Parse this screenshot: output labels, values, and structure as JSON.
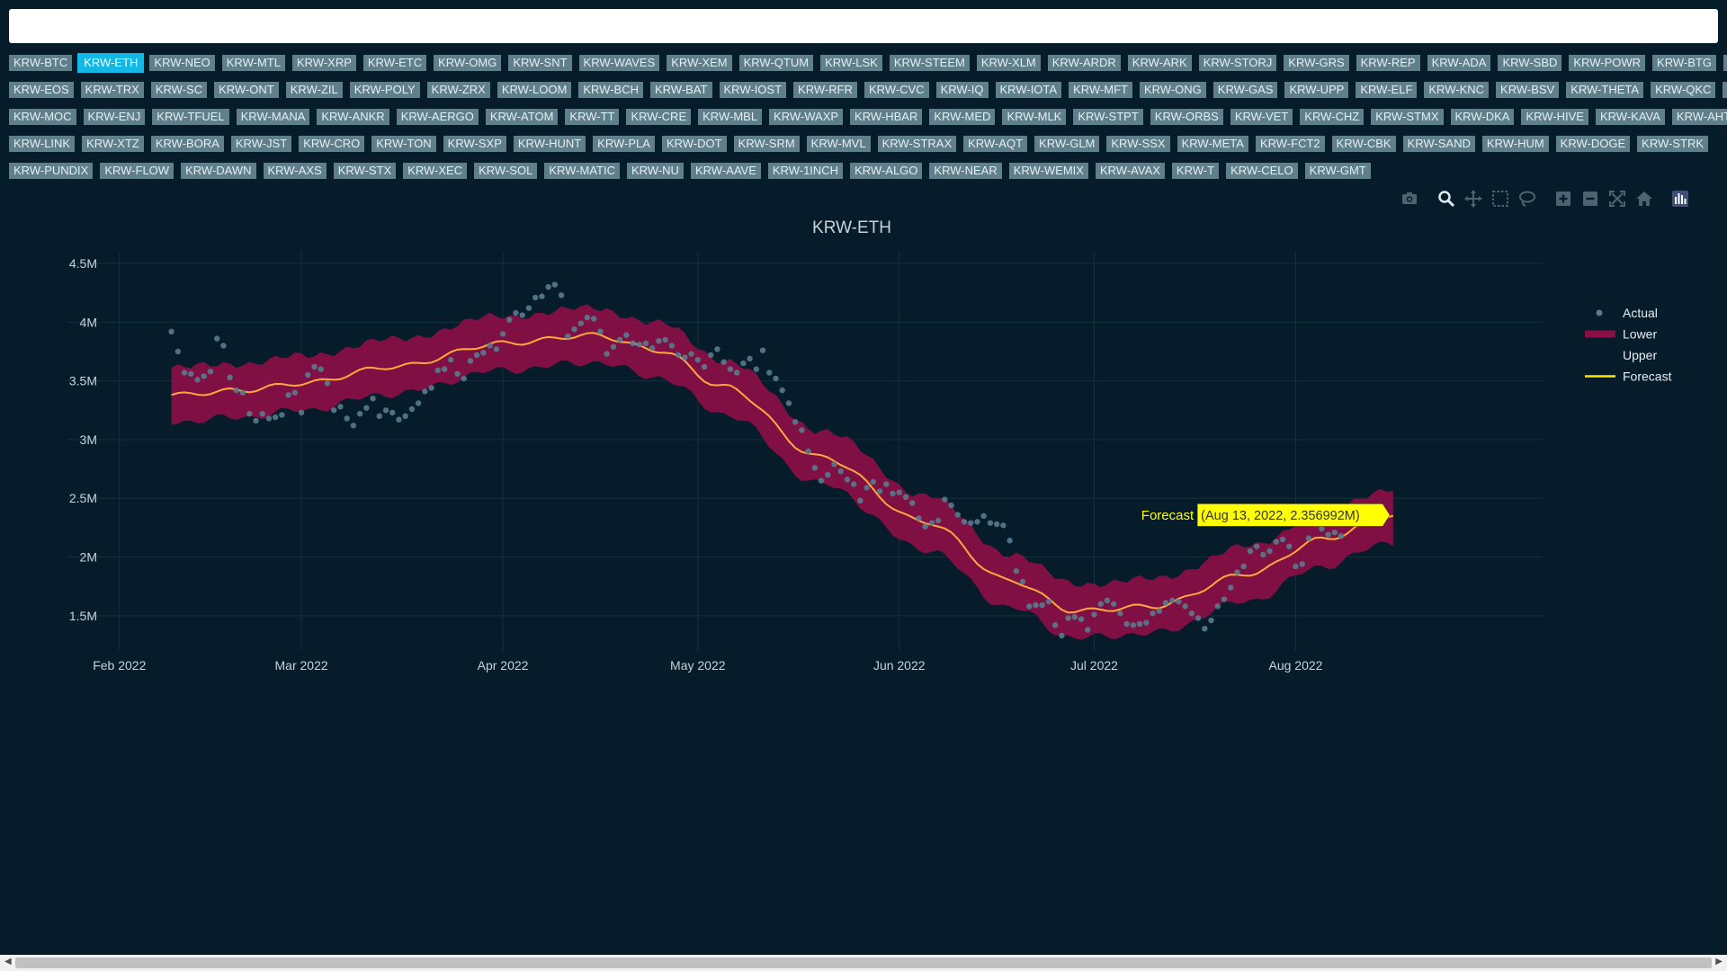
{
  "search": {
    "value": "",
    "placeholder": ""
  },
  "tickers": [
    [
      "KRW-BTC",
      "KRW-ETH",
      "KRW-NEO",
      "KRW-MTL",
      "KRW-XRP",
      "KRW-ETC",
      "KRW-OMG",
      "KRW-SNT",
      "KRW-WAVES",
      "KRW-XEM",
      "KRW-QTUM",
      "KRW-LSK",
      "KRW-STEEM",
      "KRW-XLM",
      "KRW-ARDR",
      "KRW-ARK",
      "KRW-STORJ",
      "KRW-GRS",
      "KRW-REP",
      "KRW-ADA",
      "KRW-SBD",
      "KRW-POWR",
      "KRW-BTG",
      "KRW-ICX"
    ],
    [
      "KRW-EOS",
      "KRW-TRX",
      "KRW-SC",
      "KRW-ONT",
      "KRW-ZIL",
      "KRW-POLY",
      "KRW-ZRX",
      "KRW-LOOM",
      "KRW-BCH",
      "KRW-BAT",
      "KRW-IOST",
      "KRW-RFR",
      "KRW-CVC",
      "KRW-IQ",
      "KRW-IOTA",
      "KRW-MFT",
      "KRW-ONG",
      "KRW-GAS",
      "KRW-UPP",
      "KRW-ELF",
      "KRW-KNC",
      "KRW-BSV",
      "KRW-THETA",
      "KRW-QKC",
      "KRW-BTT"
    ],
    [
      "KRW-MOC",
      "KRW-ENJ",
      "KRW-TFUEL",
      "KRW-MANA",
      "KRW-ANKR",
      "KRW-AERGO",
      "KRW-ATOM",
      "KRW-TT",
      "KRW-CRE",
      "KRW-MBL",
      "KRW-WAXP",
      "KRW-HBAR",
      "KRW-MED",
      "KRW-MLK",
      "KRW-STPT",
      "KRW-ORBS",
      "KRW-VET",
      "KRW-CHZ",
      "KRW-STMX",
      "KRW-DKA",
      "KRW-HIVE",
      "KRW-KAVA",
      "KRW-AHT"
    ],
    [
      "KRW-LINK",
      "KRW-XTZ",
      "KRW-BORA",
      "KRW-JST",
      "KRW-CRO",
      "KRW-TON",
      "KRW-SXP",
      "KRW-HUNT",
      "KRW-PLA",
      "KRW-DOT",
      "KRW-SRM",
      "KRW-MVL",
      "KRW-STRAX",
      "KRW-AQT",
      "KRW-GLM",
      "KRW-SSX",
      "KRW-META",
      "KRW-FCT2",
      "KRW-CBK",
      "KRW-SAND",
      "KRW-HUM",
      "KRW-DOGE",
      "KRW-STRK"
    ],
    [
      "KRW-PUNDIX",
      "KRW-FLOW",
      "KRW-DAWN",
      "KRW-AXS",
      "KRW-STX",
      "KRW-XEC",
      "KRW-SOL",
      "KRW-MATIC",
      "KRW-NU",
      "KRW-AAVE",
      "KRW-1INCH",
      "KRW-ALGO",
      "KRW-NEAR",
      "KRW-WEMIX",
      "KRW-AVAX",
      "KRW-T",
      "KRW-CELO",
      "KRW-GMT"
    ]
  ],
  "selected_ticker": "KRW-ETH",
  "modebar": [
    "camera-icon",
    "zoom-icon",
    "pan-icon",
    "box-select-icon",
    "lasso-icon",
    "zoom-in-icon",
    "zoom-out-icon",
    "autoscale-icon",
    "reset-axes-icon",
    "plotly-logo-icon"
  ],
  "colors": {
    "background": "#061c2b",
    "band": "#8b0f47",
    "forecast": "#ffa83c",
    "forecast_legend": "#ffe600",
    "actual": "#587b8e",
    "tooltip_bg": "#ffff00",
    "active_ticker": "#12b8e6"
  },
  "chart_data": {
    "type": "line",
    "title": "KRW-ETH",
    "x_start": "2022-02-09",
    "x_end": "2022-08-16",
    "xlim": [
      "2022-01-24",
      "2022-09-08"
    ],
    "ylim": [
      1200000,
      4600000
    ],
    "x_ticks": [
      "Feb 2022",
      "Mar 2022",
      "Apr 2022",
      "May 2022",
      "Jun 2022",
      "Jul 2022",
      "Aug 2022"
    ],
    "y_ticks": [
      "1.5M",
      "2M",
      "2.5M",
      "3M",
      "3.5M",
      "4M",
      "4.5M"
    ],
    "legend": {
      "placement": "top-right",
      "entries": [
        "Actual",
        "Lower",
        "Upper",
        "Forecast"
      ]
    },
    "forecast_knots": [
      [
        "2022-02-09",
        3380000
      ],
      [
        "2022-02-20",
        3420000
      ],
      [
        "2022-03-01",
        3480000
      ],
      [
        "2022-03-15",
        3620000
      ],
      [
        "2022-04-01",
        3820000
      ],
      [
        "2022-04-15",
        3890000
      ],
      [
        "2022-04-25",
        3760000
      ],
      [
        "2022-05-05",
        3450000
      ],
      [
        "2022-05-20",
        2850000
      ],
      [
        "2022-06-05",
        2300000
      ],
      [
        "2022-06-18",
        1800000
      ],
      [
        "2022-06-28",
        1540000
      ],
      [
        "2022-07-10",
        1580000
      ],
      [
        "2022-07-25",
        1860000
      ],
      [
        "2022-08-05",
        2150000
      ],
      [
        "2022-08-16",
        2360000
      ]
    ],
    "band_halfwidth": 230000,
    "actual_points": [
      [
        "2022-02-09",
        3920000
      ],
      [
        "2022-02-10",
        3750000
      ],
      [
        "2022-02-11",
        3570000
      ],
      [
        "2022-02-12",
        3560000
      ],
      [
        "2022-02-13",
        3510000
      ],
      [
        "2022-02-14",
        3540000
      ],
      [
        "2022-02-15",
        3580000
      ],
      [
        "2022-02-16",
        3860000
      ],
      [
        "2022-02-17",
        3800000
      ],
      [
        "2022-02-18",
        3530000
      ],
      [
        "2022-02-19",
        3420000
      ],
      [
        "2022-02-20",
        3400000
      ],
      [
        "2022-02-21",
        3220000
      ],
      [
        "2022-02-22",
        3160000
      ],
      [
        "2022-02-23",
        3220000
      ],
      [
        "2022-02-24",
        3180000
      ],
      [
        "2022-02-25",
        3190000
      ],
      [
        "2022-02-26",
        3210000
      ],
      [
        "2022-02-27",
        3380000
      ],
      [
        "2022-02-28",
        3400000
      ],
      [
        "2022-03-01",
        3230000
      ],
      [
        "2022-03-02",
        3550000
      ],
      [
        "2022-03-03",
        3620000
      ],
      [
        "2022-03-04",
        3600000
      ],
      [
        "2022-03-05",
        3480000
      ],
      [
        "2022-03-06",
        3250000
      ],
      [
        "2022-03-07",
        3280000
      ],
      [
        "2022-03-08",
        3180000
      ],
      [
        "2022-03-09",
        3120000
      ],
      [
        "2022-03-10",
        3220000
      ],
      [
        "2022-03-11",
        3270000
      ],
      [
        "2022-03-12",
        3350000
      ],
      [
        "2022-03-13",
        3200000
      ],
      [
        "2022-03-14",
        3250000
      ],
      [
        "2022-03-15",
        3230000
      ],
      [
        "2022-03-16",
        3170000
      ],
      [
        "2022-03-17",
        3200000
      ],
      [
        "2022-03-18",
        3260000
      ],
      [
        "2022-03-19",
        3310000
      ],
      [
        "2022-03-20",
        3410000
      ],
      [
        "2022-03-21",
        3440000
      ],
      [
        "2022-03-22",
        3590000
      ],
      [
        "2022-03-23",
        3600000
      ],
      [
        "2022-03-24",
        3680000
      ],
      [
        "2022-03-25",
        3560000
      ],
      [
        "2022-03-26",
        3520000
      ],
      [
        "2022-03-27",
        3670000
      ],
      [
        "2022-03-28",
        3720000
      ],
      [
        "2022-03-29",
        3740000
      ],
      [
        "2022-03-30",
        3800000
      ],
      [
        "2022-03-31",
        3770000
      ],
      [
        "2022-04-01",
        3900000
      ],
      [
        "2022-04-02",
        4020000
      ],
      [
        "2022-04-03",
        4080000
      ],
      [
        "2022-04-04",
        4060000
      ],
      [
        "2022-04-05",
        4120000
      ],
      [
        "2022-04-06",
        4210000
      ],
      [
        "2022-04-07",
        4220000
      ],
      [
        "2022-04-08",
        4300000
      ],
      [
        "2022-04-09",
        4320000
      ],
      [
        "2022-04-10",
        4230000
      ],
      [
        "2022-04-11",
        3880000
      ],
      [
        "2022-04-12",
        3940000
      ],
      [
        "2022-04-13",
        3990000
      ],
      [
        "2022-04-14",
        4040000
      ],
      [
        "2022-04-15",
        4030000
      ],
      [
        "2022-04-16",
        3920000
      ],
      [
        "2022-04-17",
        3730000
      ],
      [
        "2022-04-18",
        3790000
      ],
      [
        "2022-04-19",
        3850000
      ],
      [
        "2022-04-20",
        3890000
      ],
      [
        "2022-04-21",
        3820000
      ],
      [
        "2022-04-22",
        3810000
      ],
      [
        "2022-04-23",
        3820000
      ],
      [
        "2022-04-24",
        3780000
      ],
      [
        "2022-04-25",
        3840000
      ],
      [
        "2022-04-26",
        3850000
      ],
      [
        "2022-04-27",
        3800000
      ],
      [
        "2022-04-28",
        3720000
      ],
      [
        "2022-04-29",
        3700000
      ],
      [
        "2022-04-30",
        3730000
      ],
      [
        "2022-05-01",
        3680000
      ],
      [
        "2022-05-02",
        3620000
      ],
      [
        "2022-05-03",
        3720000
      ],
      [
        "2022-05-04",
        3770000
      ],
      [
        "2022-05-05",
        3660000
      ],
      [
        "2022-05-06",
        3600000
      ],
      [
        "2022-05-07",
        3570000
      ],
      [
        "2022-05-08",
        3650000
      ],
      [
        "2022-05-09",
        3690000
      ],
      [
        "2022-05-10",
        3600000
      ],
      [
        "2022-05-11",
        3760000
      ],
      [
        "2022-05-12",
        3570000
      ],
      [
        "2022-05-13",
        3520000
      ],
      [
        "2022-05-14",
        3420000
      ],
      [
        "2022-05-15",
        3310000
      ],
      [
        "2022-05-16",
        3150000
      ],
      [
        "2022-05-17",
        3080000
      ],
      [
        "2022-05-18",
        2900000
      ],
      [
        "2022-05-19",
        2760000
      ],
      [
        "2022-05-20",
        2650000
      ],
      [
        "2022-05-21",
        2700000
      ],
      [
        "2022-05-22",
        2790000
      ],
      [
        "2022-05-23",
        2730000
      ],
      [
        "2022-05-24",
        2660000
      ],
      [
        "2022-05-25",
        2620000
      ],
      [
        "2022-05-26",
        2480000
      ],
      [
        "2022-05-27",
        2590000
      ],
      [
        "2022-05-28",
        2640000
      ],
      [
        "2022-05-29",
        2560000
      ],
      [
        "2022-05-30",
        2620000
      ],
      [
        "2022-05-31",
        2540000
      ],
      [
        "2022-06-01",
        2550000
      ],
      [
        "2022-06-02",
        2510000
      ],
      [
        "2022-06-03",
        2460000
      ],
      [
        "2022-06-04",
        2330000
      ],
      [
        "2022-06-05",
        2260000
      ],
      [
        "2022-06-06",
        2290000
      ],
      [
        "2022-06-07",
        2310000
      ],
      [
        "2022-06-08",
        2490000
      ],
      [
        "2022-06-09",
        2440000
      ],
      [
        "2022-06-10",
        2360000
      ],
      [
        "2022-06-11",
        2300000
      ],
      [
        "2022-06-12",
        2290000
      ],
      [
        "2022-06-13",
        2300000
      ],
      [
        "2022-06-14",
        2350000
      ],
      [
        "2022-06-15",
        2290000
      ],
      [
        "2022-06-16",
        2280000
      ],
      [
        "2022-06-17",
        2270000
      ],
      [
        "2022-06-18",
        2140000
      ],
      [
        "2022-06-19",
        1880000
      ],
      [
        "2022-06-20",
        1790000
      ],
      [
        "2022-06-21",
        1580000
      ],
      [
        "2022-06-22",
        1590000
      ],
      [
        "2022-06-23",
        1590000
      ],
      [
        "2022-06-24",
        1620000
      ],
      [
        "2022-06-25",
        1420000
      ],
      [
        "2022-06-26",
        1330000
      ],
      [
        "2022-06-27",
        1480000
      ],
      [
        "2022-06-28",
        1490000
      ],
      [
        "2022-06-29",
        1470000
      ],
      [
        "2022-06-30",
        1380000
      ],
      [
        "2022-07-01",
        1510000
      ],
      [
        "2022-07-02",
        1600000
      ],
      [
        "2022-07-03",
        1630000
      ],
      [
        "2022-07-04",
        1600000
      ],
      [
        "2022-07-05",
        1520000
      ],
      [
        "2022-07-06",
        1430000
      ],
      [
        "2022-07-07",
        1420000
      ],
      [
        "2022-07-08",
        1430000
      ],
      [
        "2022-07-09",
        1440000
      ],
      [
        "2022-07-10",
        1520000
      ],
      [
        "2022-07-11",
        1540000
      ],
      [
        "2022-07-12",
        1610000
      ],
      [
        "2022-07-13",
        1630000
      ],
      [
        "2022-07-14",
        1620000
      ],
      [
        "2022-07-15",
        1580000
      ],
      [
        "2022-07-16",
        1520000
      ],
      [
        "2022-07-17",
        1480000
      ],
      [
        "2022-07-18",
        1390000
      ],
      [
        "2022-07-19",
        1460000
      ],
      [
        "2022-07-20",
        1580000
      ],
      [
        "2022-07-21",
        1640000
      ],
      [
        "2022-07-22",
        1740000
      ],
      [
        "2022-07-23",
        1870000
      ],
      [
        "2022-07-24",
        1920000
      ],
      [
        "2022-07-25",
        2050000
      ],
      [
        "2022-07-26",
        2090000
      ],
      [
        "2022-07-27",
        2020000
      ],
      [
        "2022-07-28",
        2050000
      ],
      [
        "2022-07-29",
        2130000
      ],
      [
        "2022-07-30",
        2150000
      ],
      [
        "2022-07-31",
        2090000
      ],
      [
        "2022-08-01",
        1920000
      ],
      [
        "2022-08-02",
        1940000
      ],
      [
        "2022-08-03",
        2160000
      ],
      [
        "2022-08-04",
        2280000
      ],
      [
        "2022-08-05",
        2240000
      ],
      [
        "2022-08-06",
        2190000
      ],
      [
        "2022-08-07",
        2210000
      ],
      [
        "2022-08-08",
        2180000
      ]
    ],
    "hover": {
      "series": "Forecast",
      "label": "(Aug 13, 2022, 2.356992M)",
      "x": "2022-08-13",
      "y": 2356992
    }
  }
}
